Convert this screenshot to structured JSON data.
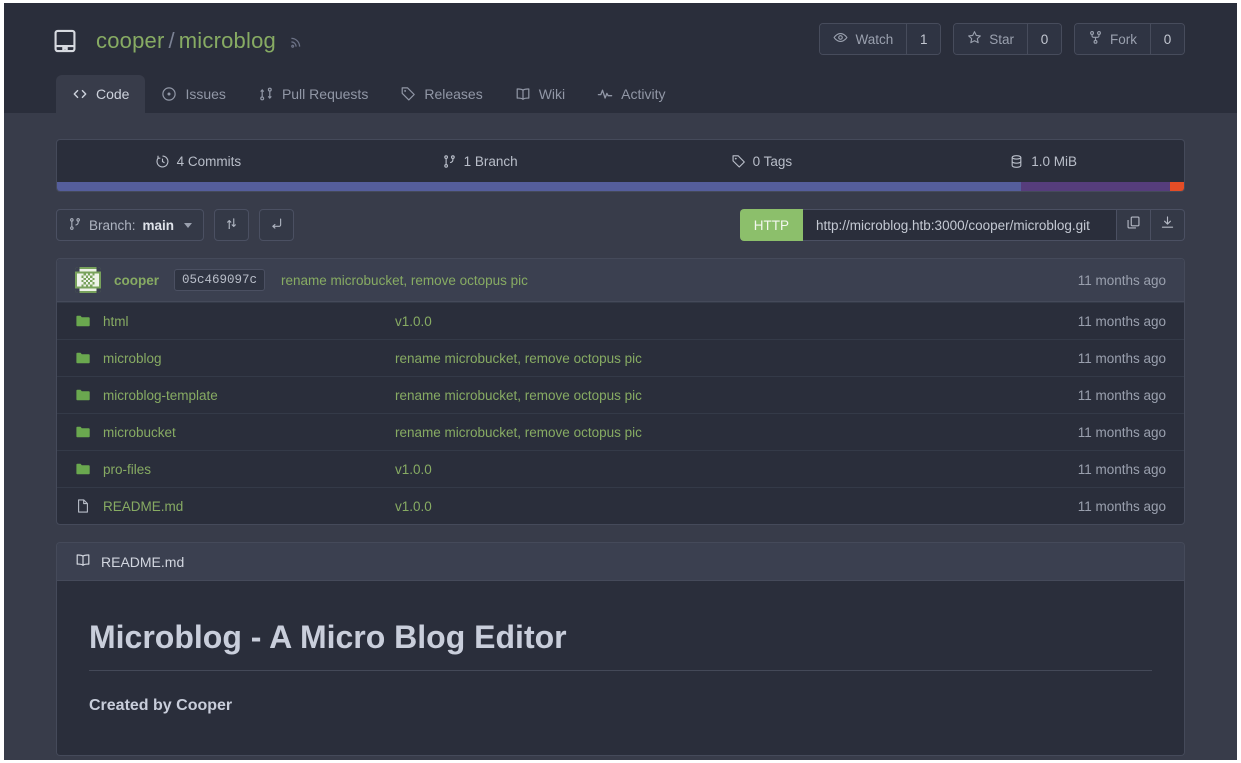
{
  "header": {
    "repo_icon": "repo-icon",
    "owner": "cooper",
    "separator": "/",
    "repo": "microblog",
    "rss_icon": "rss-icon",
    "actions": [
      {
        "icon": "eye-icon",
        "label": "Watch",
        "count": "1"
      },
      {
        "icon": "star-icon",
        "label": "Star",
        "count": "0"
      },
      {
        "icon": "fork-icon",
        "label": "Fork",
        "count": "0"
      }
    ],
    "tabs": [
      {
        "icon": "code-icon",
        "label": "Code",
        "active": true
      },
      {
        "icon": "issues-icon",
        "label": "Issues",
        "active": false
      },
      {
        "icon": "pull-request-icon",
        "label": "Pull Requests",
        "active": false
      },
      {
        "icon": "tag-icon",
        "label": "Releases",
        "active": false
      },
      {
        "icon": "book-icon",
        "label": "Wiki",
        "active": false
      },
      {
        "icon": "activity-icon",
        "label": "Activity",
        "active": false
      }
    ]
  },
  "stats": [
    {
      "icon": "clock-icon",
      "label": "4 Commits"
    },
    {
      "icon": "branch-icon",
      "label": "1 Branch"
    },
    {
      "icon": "tag-icon",
      "label": "0 Tags"
    },
    {
      "icon": "database-icon",
      "label": "1.0 MiB"
    }
  ],
  "language_bar": [
    {
      "name": "blue-segment",
      "color": "#555e9c",
      "percent": 85.5
    },
    {
      "name": "purple-segment",
      "color": "#563d7c",
      "percent": 13.3
    },
    {
      "name": "orange-segment",
      "color": "#e44d26",
      "percent": 1.2
    }
  ],
  "clone": {
    "branch_prefix": "Branch:",
    "branch_name": "main",
    "branch_icon": "branch-icon",
    "compare_icon": "compare-icon",
    "new_pr_icon": "new-pull-request-icon",
    "protocol_label": "HTTP",
    "url": "http://microblog.htb:3000/cooper/microblog.git",
    "copy_icon": "copy-icon",
    "download_icon": "download-icon"
  },
  "commit_header": {
    "avatar": "cooper-avatar",
    "author": "cooper",
    "sha": "05c469097c",
    "message": "rename microbucket, remove octopus pic",
    "age": "11 months ago"
  },
  "files": [
    {
      "icon": "folder-icon",
      "name": "html",
      "message": "v1.0.0",
      "age": "11 months ago"
    },
    {
      "icon": "folder-icon",
      "name": "microblog",
      "message": "rename microbucket, remove octopus pic",
      "age": "11 months ago"
    },
    {
      "icon": "folder-icon",
      "name": "microblog-template",
      "message": "rename microbucket, remove octopus pic",
      "age": "11 months ago"
    },
    {
      "icon": "folder-icon",
      "name": "microbucket",
      "message": "rename microbucket, remove octopus pic",
      "age": "11 months ago"
    },
    {
      "icon": "folder-icon",
      "name": "pro-files",
      "message": "v1.0.0",
      "age": "11 months ago"
    },
    {
      "icon": "file-icon",
      "name": "README.md",
      "message": "v1.0.0",
      "age": "11 months ago"
    }
  ],
  "readme": {
    "icon": "book-icon",
    "title": "README.md",
    "heading": "Microblog - A Micro Blog Editor",
    "subheading": "Created by Cooper"
  },
  "colors": {
    "page_bg": "#383c4a",
    "header_bg": "#2a2e3b",
    "panel_bg": "#2a2e3b",
    "accent_green": "#87ab63",
    "http_green": "#8cbf6b",
    "muted_text": "#9aa0ae"
  }
}
